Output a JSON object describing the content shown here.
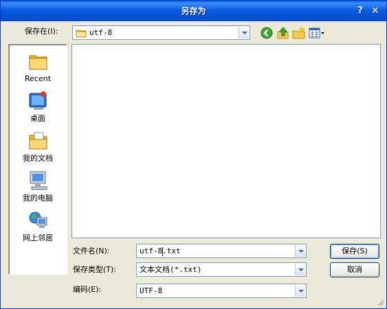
{
  "window": {
    "title": "另存为",
    "help_label": "?",
    "close_label": "✕"
  },
  "toolbar": {
    "save_in_label": "保存在(I):",
    "save_in_value": "utf-8",
    "icons": [
      "back-icon",
      "up-folder-icon",
      "new-folder-icon",
      "view-menu-icon"
    ]
  },
  "places": [
    {
      "id": "recent",
      "label": "Recent",
      "icon": "recent-folder-icon"
    },
    {
      "id": "desktop",
      "label": "桌面",
      "icon": "desktop-icon"
    },
    {
      "id": "mydocs",
      "label": "我的文档",
      "icon": "my-documents-icon"
    },
    {
      "id": "mycomputer",
      "label": "我的电脑",
      "icon": "my-computer-icon"
    },
    {
      "id": "network",
      "label": "网上邻居",
      "icon": "network-places-icon"
    }
  ],
  "form": {
    "filename_label": "文件名(N):",
    "filename_value": "utf-8.txt",
    "filetype_label": "保存类型(T):",
    "filetype_value": "文本文档(*.txt)",
    "encoding_label": "编码(E):",
    "encoding_value": "UTF-8"
  },
  "buttons": {
    "save": "保存(S)",
    "cancel": "取消"
  },
  "colors": {
    "titlebar": "#0a5fe6",
    "dialog_bg": "#ece9d8",
    "field_border": "#7f9db9"
  }
}
